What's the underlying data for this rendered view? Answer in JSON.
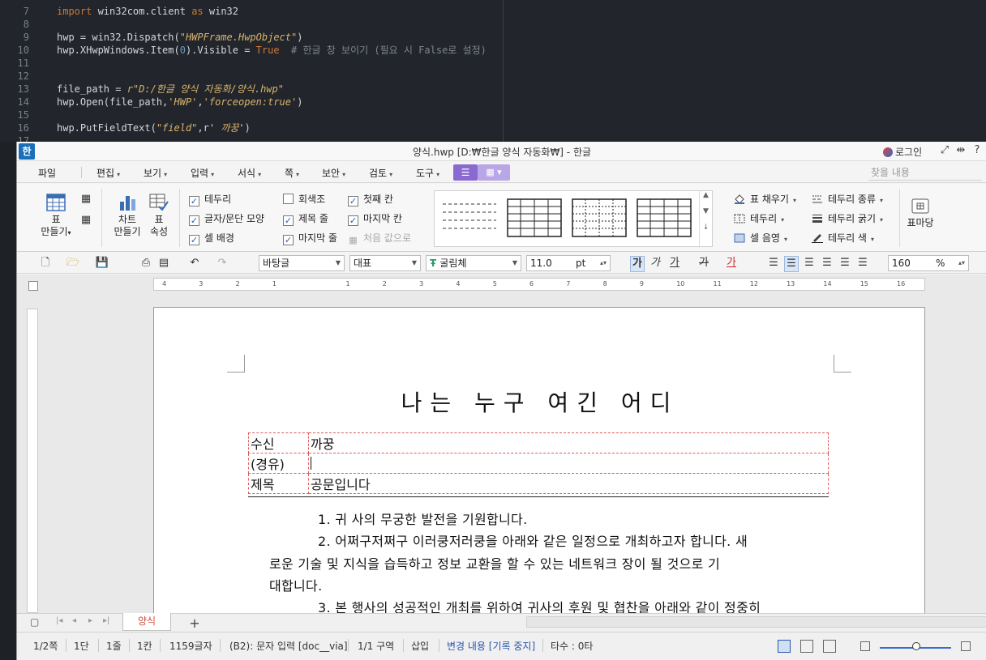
{
  "editor": {
    "lines": [
      {
        "n": "7",
        "tokens": [
          [
            "kw",
            "import"
          ],
          [
            "fn",
            " win32com.client "
          ],
          [
            "kw",
            "as"
          ],
          [
            "fn",
            " win32"
          ]
        ]
      },
      {
        "n": "8",
        "tokens": []
      },
      {
        "n": "9",
        "tokens": [
          [
            "fn",
            "hwp = win32.Dispatch("
          ],
          [
            "str",
            "\"HWPFrame.HwpObject\""
          ],
          [
            "fn",
            ")"
          ]
        ]
      },
      {
        "n": "10",
        "tokens": [
          [
            "fn",
            "hwp.XHwpWindows.Item("
          ],
          [
            "num",
            "0"
          ],
          [
            "fn",
            ").Visible = "
          ],
          [
            "bool",
            "True"
          ],
          [
            "cm",
            "  # 한글 창 보이기 (필요 시 False로 설정)"
          ]
        ]
      },
      {
        "n": "11",
        "tokens": []
      },
      {
        "n": "12",
        "tokens": []
      },
      {
        "n": "13",
        "tokens": [
          [
            "fn",
            "file_path = "
          ],
          [
            "str",
            "r\"D:/한글 양식 자동화/양식.hwp\""
          ]
        ]
      },
      {
        "n": "14",
        "tokens": [
          [
            "fn",
            "hwp.Open(file_path,"
          ],
          [
            "str",
            "'HWP'"
          ],
          [
            "fn",
            ","
          ],
          [
            "str",
            "'forceopen:true'"
          ],
          [
            "fn",
            ")"
          ]
        ]
      },
      {
        "n": "15",
        "tokens": []
      },
      {
        "n": "16",
        "tokens": [
          [
            "fn",
            "hwp.PutFieldText("
          ],
          [
            "str",
            "\"field\""
          ],
          [
            "fn",
            ",r' "
          ],
          [
            "str",
            "까꿍"
          ],
          [
            "fn",
            "')"
          ]
        ]
      },
      {
        "n": "17",
        "tokens": []
      }
    ]
  },
  "window": {
    "logo": "한",
    "title": "양식.hwp [D:₩한글 양식 자동화₩] - 한글",
    "login": "로그인"
  },
  "menubar": {
    "items": [
      "파일",
      "편집",
      "보기",
      "입력",
      "서식",
      "쪽",
      "보안",
      "검토",
      "도구"
    ],
    "find_placeholder": "찾을 내용"
  },
  "ribbon": {
    "table_make": [
      "표",
      "만들기"
    ],
    "chart_make": [
      "차트",
      "만들기"
    ],
    "table_props": [
      "표",
      "속성"
    ],
    "checks": [
      {
        "label": "테두리",
        "checked": true,
        "disabled": false
      },
      {
        "label": "글자/문단 모양",
        "checked": true,
        "disabled": false
      },
      {
        "label": "셀 배경",
        "checked": true,
        "disabled": false
      },
      {
        "label": "회색조",
        "checked": false,
        "disabled": false
      },
      {
        "label": "제목 줄",
        "checked": true,
        "disabled": false
      },
      {
        "label": "마지막 줄",
        "checked": true,
        "disabled": false
      },
      {
        "label": "첫째 칸",
        "checked": true,
        "disabled": false
      },
      {
        "label": "마지막 칸",
        "checked": true,
        "disabled": false
      },
      {
        "label": "처음 값으로",
        "checked": false,
        "disabled": true
      }
    ],
    "right_col1": [
      "표 채우기",
      "테두리",
      "셀 음영"
    ],
    "right_col2": [
      "테두리 종류",
      "테두리 굵기",
      "테두리 색"
    ],
    "table_mart": "표마당"
  },
  "format": {
    "style": "바탕글",
    "lang": "대표",
    "font": "굴림체",
    "size": "11.0",
    "unit": "pt",
    "bold": "가",
    "italic": "가",
    "underline": "가",
    "strike": "가",
    "color": "가",
    "zoom": "160",
    "zoom_unit": "%"
  },
  "ruler": {
    "ticks": [
      "4",
      "3",
      "2",
      "1",
      "",
      "1",
      "2",
      "3",
      "4",
      "5",
      "6",
      "7",
      "8",
      "9",
      "10",
      "11",
      "12",
      "13",
      "14",
      "15",
      "16"
    ]
  },
  "document": {
    "title": "나는 누구 여긴 어디",
    "rows": [
      {
        "key": "수신",
        "value": " 까꿍"
      },
      {
        "key": "(경유)",
        "value": ""
      },
      {
        "key": "제목",
        "value": "공문입니다"
      }
    ],
    "paragraphs": [
      "1.  귀 사의 무궁한 발전을 기원합니다.",
      "2.  어쩌구저쩌구 이러쿵저러쿵을 아래와 같은 일정으로 개최하고자 합니다. 새",
      "로운 기술 및 지식을 습득하고 정보 교환을 할 수 있는 네트워크 장이 될 것으로 기",
      "대합니다.",
      "3.  본 행사의 성공적인 개최를 위하여 귀사의 후원 및 협찬을 아래와 같이 정중히"
    ]
  },
  "tabs": {
    "sheet": "양식",
    "add": "+"
  },
  "status": {
    "page": "1/2쪽",
    "col": "1단",
    "line": "1줄",
    "cell": "1칸",
    "chars": "1159글자",
    "field": "(B2): 문자 입력 [doc__via]",
    "section": "1/1 구역",
    "insert": "삽입",
    "track": "변경 내용 [기록 중지]",
    "typing": "타수 : 0타"
  },
  "colors": {
    "accent": "#8a6ad0",
    "status_blue": "#2a56b0",
    "tab_red": "#d04a3c"
  }
}
